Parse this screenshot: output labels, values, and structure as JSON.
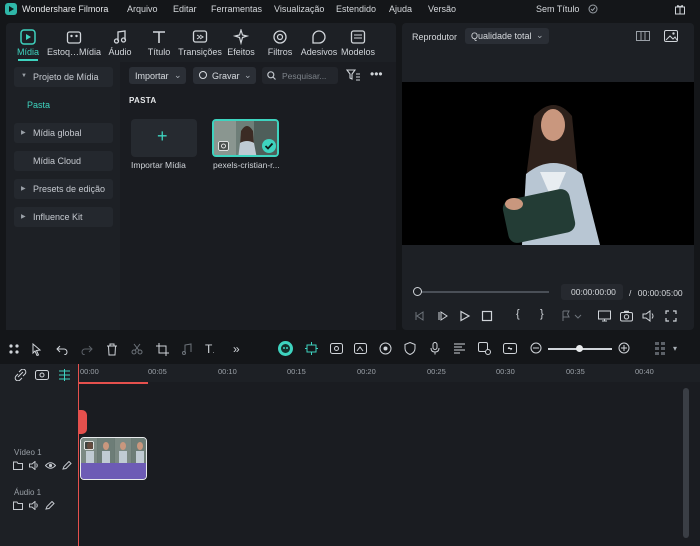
{
  "app": {
    "name": "Wondershare Filmora",
    "project_title": "Sem Título",
    "menu": [
      "Arquivo",
      "Editar",
      "Ferramentas",
      "Visualização",
      "Estendido",
      "Ajuda",
      "Versão"
    ]
  },
  "media_tabs": [
    {
      "label": "Mídia",
      "icon": "media-icon",
      "active": true
    },
    {
      "label": "Estoq…Mídia",
      "icon": "stock-media-icon"
    },
    {
      "label": "Áudio",
      "icon": "music-note-icon"
    },
    {
      "label": "Título",
      "icon": "title-t-icon"
    },
    {
      "label": "Transições",
      "icon": "transitions-icon"
    },
    {
      "label": "Efeitos",
      "icon": "effects-sparkle-icon"
    },
    {
      "label": "Filtros",
      "icon": "filters-icon"
    },
    {
      "label": "Adesivos",
      "icon": "stickers-icon"
    },
    {
      "label": "Modelos",
      "icon": "templates-icon"
    }
  ],
  "sidebar": {
    "project_media": "Projeto de Mídia",
    "folder": "Pasta",
    "global_media": "Mídia global",
    "cloud_media": "Mídia Cloud",
    "edit_presets": "Presets de edição",
    "influence_kit": "Influence Kit"
  },
  "media_toolbar": {
    "import_label": "Importar",
    "record_label": "Gravar",
    "search_placeholder": "Pesquisar..."
  },
  "media_area": {
    "folder_label": "PASTA",
    "import_card_label": "Importar Mídia",
    "clip_card_label": "pexels-cristian-r..."
  },
  "player": {
    "label": "Reprodutor",
    "quality": "Qualidade total",
    "current_time": "00:00:00:00",
    "separator": "/",
    "total_time": "00:00:05:00",
    "progress": 0
  },
  "timeline": {
    "ruler": [
      "00:00",
      "00:05",
      "00:10",
      "00:15",
      "00:20",
      "00:25",
      "00:30",
      "00:35",
      "00:40"
    ],
    "video_track": "Vídeo 1",
    "audio_track": "Áudio 1"
  },
  "colors": {
    "accent": "#3ed3bf",
    "playhead": "#e5504d",
    "clip_audio": "#6d5bb5",
    "background": "#141619",
    "panel": "#1d2025"
  }
}
